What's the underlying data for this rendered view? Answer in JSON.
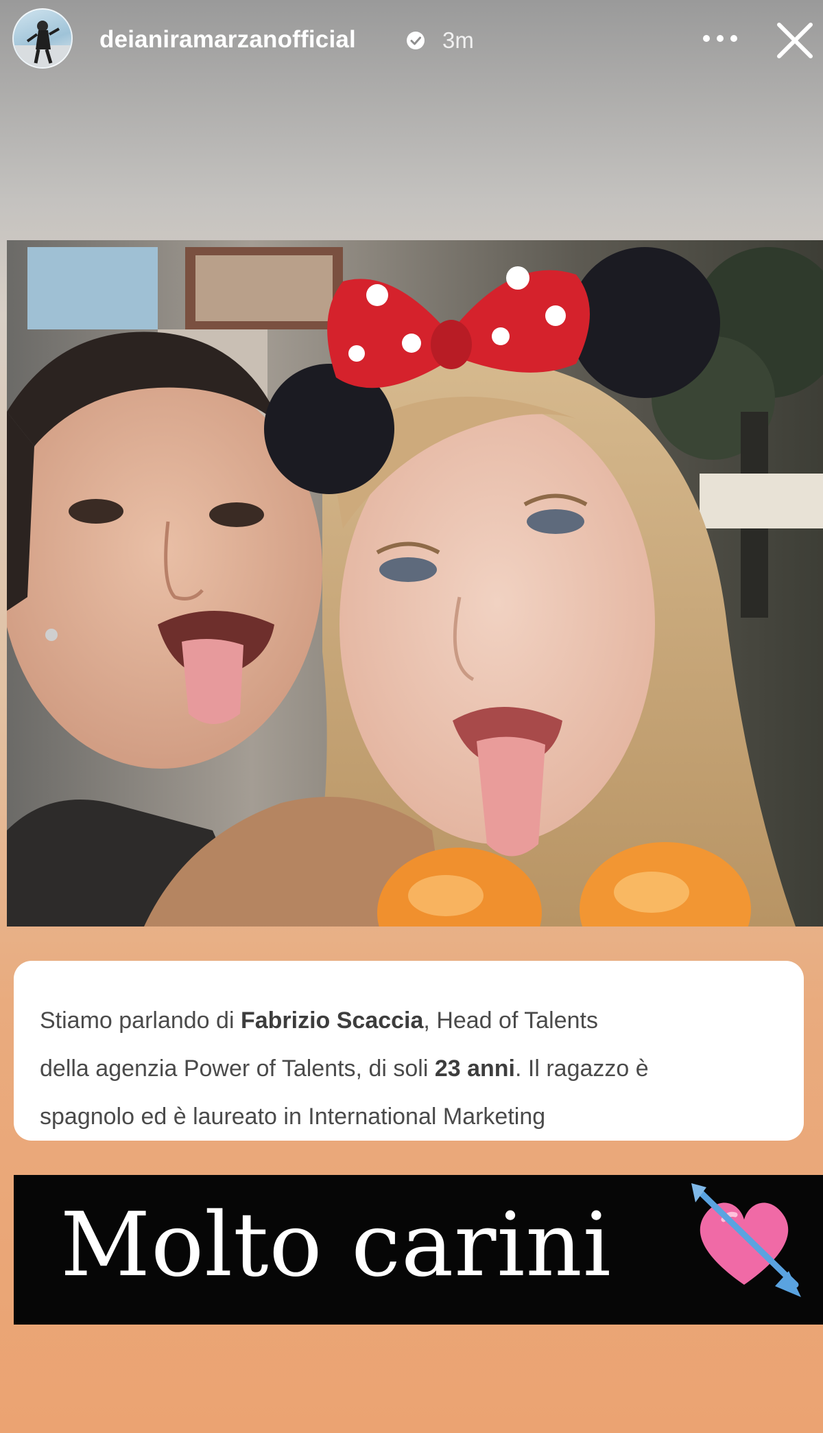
{
  "header": {
    "username": "deianiramarzanofficial",
    "timestamp": "3m",
    "more_icon": "more-horizontal-icon",
    "close_icon": "close-icon",
    "verified_icon": "verified-badge-icon"
  },
  "caption": {
    "line1_pre": "Stiamo parlando di ",
    "line1_bold": "Fabrizio Scaccia",
    "line1_post": ", Head of Talents",
    "line2_pre": "della agenzia Power of Talents, di soli ",
    "line2_bold": "23 anni",
    "line2_post": ". Il ragazzo è",
    "line3": "spagnolo ed è laureato in International Marketing"
  },
  "sticker": {
    "text": "Molto carini",
    "emoji_icon": "heart-with-arrow-icon"
  },
  "colors": {
    "sticker_bg": "#060606",
    "gradient_bottom": "#eba372",
    "heart": "#f06aa6",
    "arrow": "#5aa3e0"
  }
}
